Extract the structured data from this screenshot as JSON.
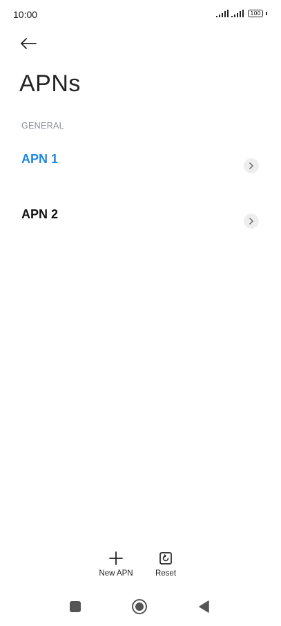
{
  "status_bar": {
    "time": "10:00",
    "battery": "100",
    "icons": [
      "signal-icon",
      "signal-icon",
      "battery-icon"
    ]
  },
  "header": {
    "back_icon": "arrow-left-icon",
    "title": "APNs"
  },
  "section": {
    "label": "GENERAL"
  },
  "apns": [
    {
      "label": "APN 1",
      "selected": true,
      "color": "#1e88e5"
    },
    {
      "label": "APN 2",
      "selected": false,
      "color": "#111111"
    }
  ],
  "actions": {
    "new_apn": {
      "label": "New APN",
      "icon": "plus-icon"
    },
    "reset": {
      "label": "Reset",
      "icon": "reset-icon"
    }
  },
  "nav": {
    "recent_icon": "square-icon",
    "home_icon": "circle-icon",
    "back_icon": "triangle-back-icon"
  }
}
